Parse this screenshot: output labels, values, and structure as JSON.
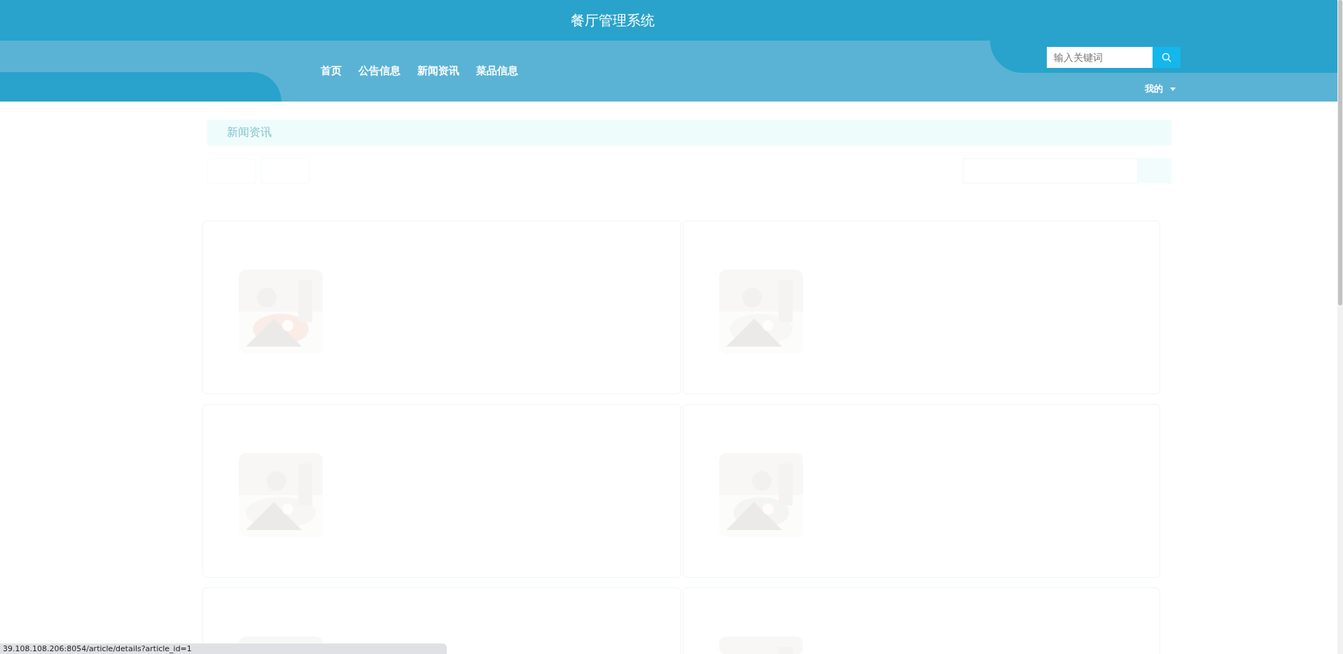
{
  "header": {
    "title": "餐厅管理系统",
    "nav": [
      {
        "label": "首页"
      },
      {
        "label": "公告信息"
      },
      {
        "label": "新闻资讯"
      },
      {
        "label": "菜品信息"
      }
    ],
    "search": {
      "placeholder": "输入关键词"
    },
    "user_menu": "我的"
  },
  "section": {
    "title": "新闻资讯"
  },
  "status_url": "39.108.108.206:8054/article/details?article_id=1"
}
